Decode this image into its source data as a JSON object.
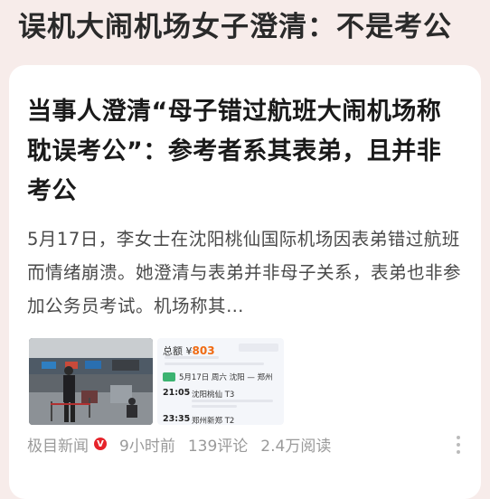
{
  "top_title": "误机大闹机场女子澄清：不是考公",
  "article": {
    "headline": "当事人澄清“母子错过航班大闹机场称耽误考公”：参考者系其表弟，且并非考公",
    "summary": "5月17日，李女士在沈阳桃仙国际机场因表弟错过航班而情绪崩溃。她澄清与表弟并非母子关系，表弟也非参加公务员考试。机场称其…",
    "source": "极目新闻",
    "verified_badge": "V",
    "time": "9小时前",
    "comments": "139评论",
    "reads": "2.4万阅读",
    "ticket": {
      "price_prefix": "总额 ¥",
      "price": "803",
      "date": "5月17日 周六 沈阳 — 郑州",
      "dep_time": "21:05",
      "dep_place": "沈阳桃仙 T3",
      "arr_time": "23:35",
      "arr_place": "郑州新郑 T2"
    }
  },
  "colors": {
    "page_bg": "#f7ecea",
    "card_bg": "#ffffff",
    "badge_red": "#e6242b",
    "price_orange": "#f06a12"
  }
}
